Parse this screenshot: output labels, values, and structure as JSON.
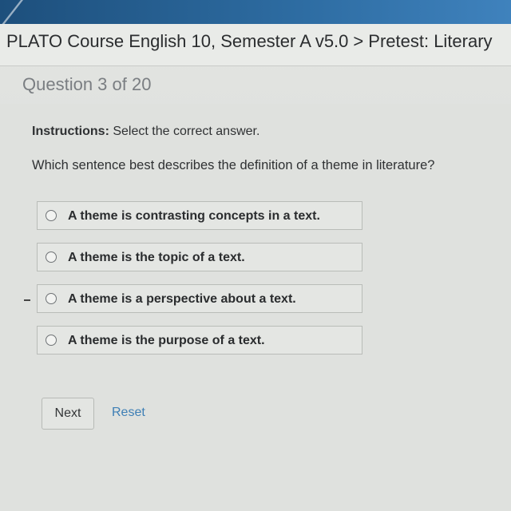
{
  "breadcrumb": {
    "course": "PLATO Course English 10, Semester A v5.0",
    "separator": ">",
    "current": "Pretest: Literary"
  },
  "question": {
    "counter": "Question 3 of 20",
    "instructions_label": "Instructions:",
    "instructions_text": " Select the correct answer.",
    "prompt": "Which sentence best describes the definition of a theme in literature?"
  },
  "options": [
    {
      "label": "A theme is contrasting concepts in a text."
    },
    {
      "label": "A theme is the topic of a text."
    },
    {
      "label": "A theme is a perspective about a text."
    },
    {
      "label": "A theme is the purpose of a text."
    }
  ],
  "actions": {
    "next_label": "Next",
    "reset_label": "Reset"
  },
  "colors": {
    "link": "#3e7fb5",
    "top_strip": "#2e6da3"
  }
}
